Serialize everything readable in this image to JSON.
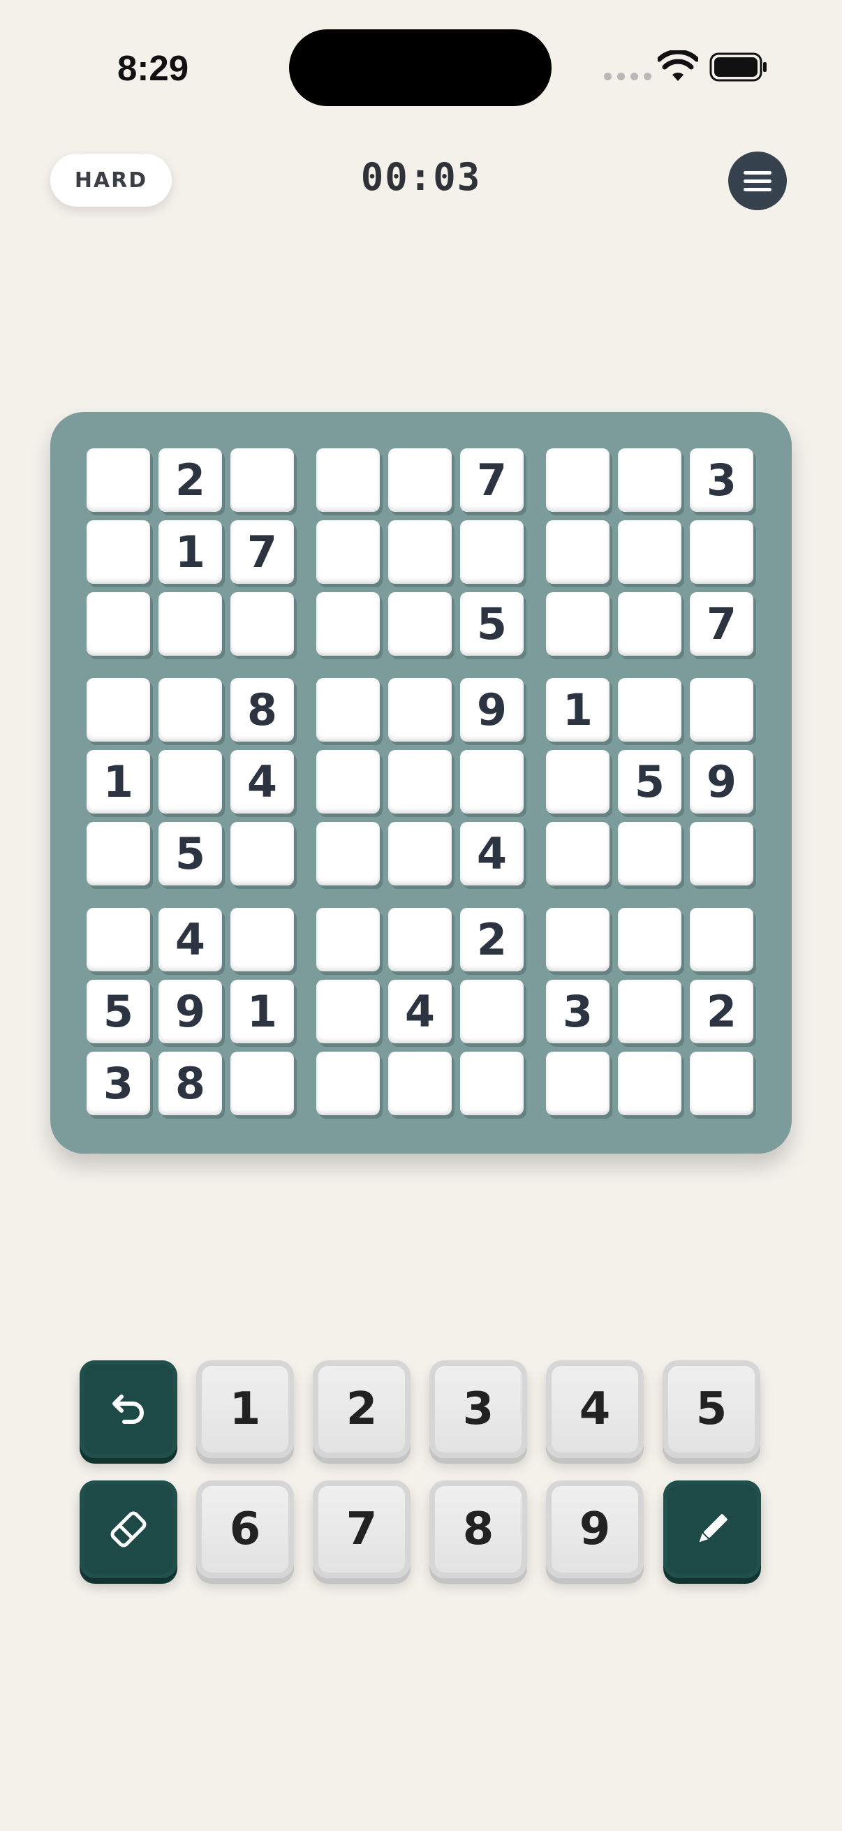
{
  "status_bar": {
    "time": "8:29"
  },
  "header": {
    "difficulty": "HARD",
    "timer": "00:03"
  },
  "board": {
    "rows": [
      [
        "",
        "2",
        "",
        "",
        "",
        "7",
        "",
        "",
        "3"
      ],
      [
        "",
        "1",
        "7",
        "",
        "",
        "",
        "",
        "",
        ""
      ],
      [
        "",
        "",
        "",
        "",
        "",
        "5",
        "",
        "",
        "7"
      ],
      [
        "",
        "",
        "8",
        "",
        "",
        "9",
        "1",
        "",
        ""
      ],
      [
        "1",
        "",
        "4",
        "",
        "",
        "",
        "",
        "5",
        "9"
      ],
      [
        "",
        "5",
        "",
        "",
        "",
        "4",
        "",
        "",
        ""
      ],
      [
        "",
        "4",
        "",
        "",
        "",
        "2",
        "",
        "",
        ""
      ],
      [
        "5",
        "9",
        "1",
        "",
        "4",
        "",
        "3",
        "",
        "2"
      ],
      [
        "3",
        "8",
        "",
        "",
        "",
        "",
        "",
        "",
        ""
      ]
    ]
  },
  "keypad": {
    "row1": [
      "1",
      "2",
      "3",
      "4",
      "5"
    ],
    "row2": [
      "6",
      "7",
      "8",
      "9"
    ],
    "undo_icon": "undo-icon",
    "erase_icon": "eraser-icon",
    "notes_icon": "pencil-icon"
  },
  "colors": {
    "background": "#f4f1eb",
    "board": "#7c9c9c",
    "accent": "#1d4a46",
    "menu": "#37424f"
  }
}
